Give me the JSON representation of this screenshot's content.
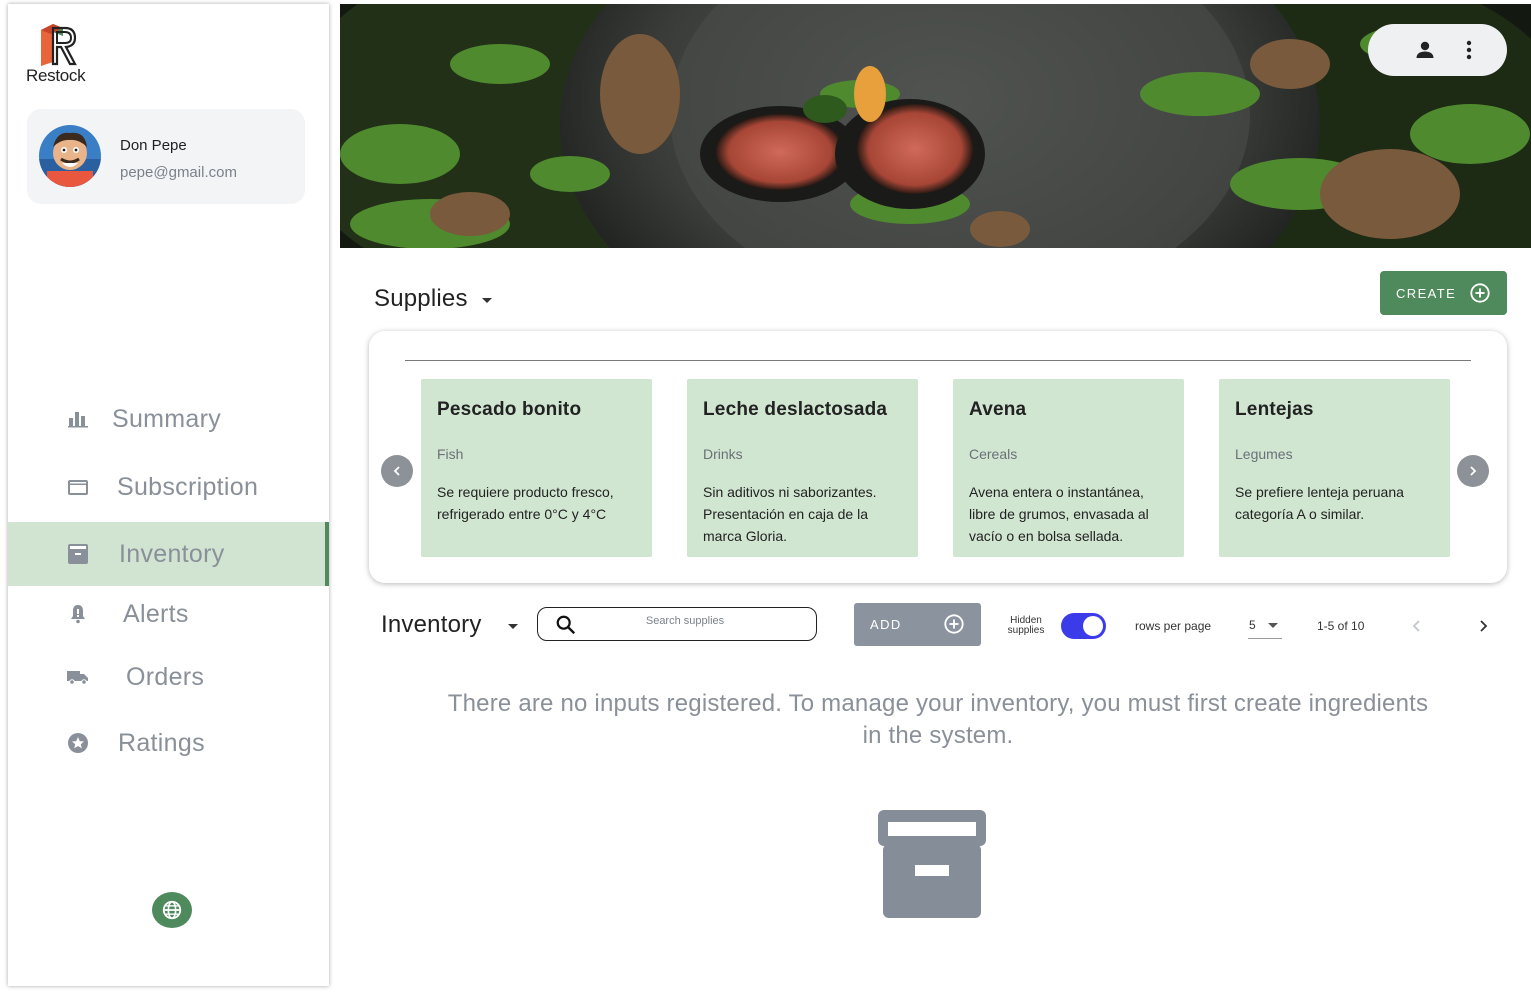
{
  "app": {
    "logo_text": "Restock"
  },
  "user": {
    "name": "Don Pepe",
    "email": "pepe@gmail.com"
  },
  "sidebar": {
    "items": [
      {
        "label": "Summary",
        "icon": "bar-chart-icon",
        "active": false
      },
      {
        "label": "Subscription",
        "icon": "credit-card-icon",
        "active": false
      },
      {
        "label": "Inventory",
        "icon": "archive-icon",
        "active": true
      },
      {
        "label": "Alerts",
        "icon": "bell-alert-icon",
        "active": false
      },
      {
        "label": "Orders",
        "icon": "truck-icon",
        "active": false
      },
      {
        "label": "Ratings",
        "icon": "star-circle-icon",
        "active": false
      }
    ],
    "language_icon": "globe-icon"
  },
  "supplies": {
    "title": "Supplies",
    "create_label": "CREATE",
    "cards": [
      {
        "title": "Pescado bonito",
        "category": "Fish",
        "description": "Se requiere producto fresco, refrigerado entre 0°C y 4°C"
      },
      {
        "title": "Leche deslactosada",
        "category": "Drinks",
        "description": "Sin aditivos ni saborizantes. Presentación en caja de la marca Gloria."
      },
      {
        "title": "Avena",
        "category": "Cereals",
        "description": "Avena entera o instantánea, libre de grumos, envasada al vacío o en bolsa sellada."
      },
      {
        "title": "Lentejas",
        "category": "Legumes",
        "description": "Se prefiere lenteja peruana categoría A o similar."
      }
    ]
  },
  "inventory": {
    "title": "Inventory",
    "search_placeholder": "Search supplies",
    "add_label": "ADD",
    "hidden_label": "Hidden supplies",
    "hidden_enabled": true,
    "rows_per_page_label": "rows per page",
    "rows_per_page_value": "5",
    "range_text": "1-5 of 10",
    "empty_message": "There are no inputs registered. To manage your inventory, you must first create ingredients in the system."
  },
  "colors": {
    "accent_green": "#4e8a5b",
    "card_green": "#d0e6d1",
    "toggle_blue": "#3b3bea",
    "muted_gray": "#8a9099"
  }
}
